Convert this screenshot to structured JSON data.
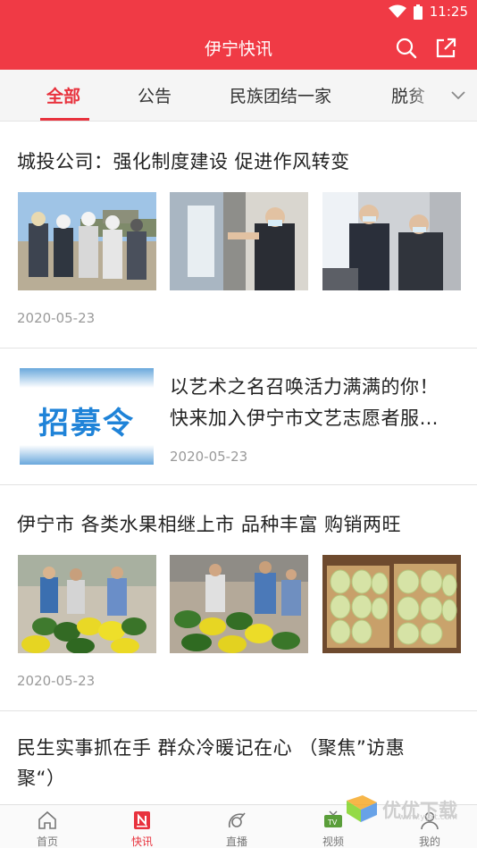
{
  "status_bar": {
    "time": "11:25"
  },
  "header": {
    "title": "伊宁快讯"
  },
  "tabs": [
    {
      "label": "全部",
      "active": true
    },
    {
      "label": "公告",
      "active": false
    },
    {
      "label": "民族团结一家",
      "active": false
    },
    {
      "label": "脱贫",
      "active": false
    }
  ],
  "articles": [
    {
      "title": "城投公司：强化制度建设   促进作风转变",
      "date": "2020-05-23",
      "images": [
        "construction-site-photo",
        "office-inspection-photo",
        "meeting-photo"
      ]
    },
    {
      "title_line1": "以艺术之名召唤活力满满的你！",
      "title_line2": "快来加入伊宁市文艺志愿者服…",
      "date": "2020-05-23",
      "banner_text": "招募令"
    },
    {
      "title": "伊宁市   各类水果相继上市   品种丰富   购销两旺",
      "date": "2020-05-23",
      "images": [
        "watermelon-market-photo",
        "watermelon-stall-photo",
        "melon-boxes-photo"
      ]
    },
    {
      "title_line1": "民生实事抓在手   群众冷暖记在心     （聚焦”访惠",
      "title_line2": "聚“）"
    }
  ],
  "bottom_nav": [
    {
      "label": "首页",
      "icon": "home-icon",
      "active": false
    },
    {
      "label": "快讯",
      "icon": "news-icon",
      "active": true
    },
    {
      "label": "直播",
      "icon": "live-icon",
      "active": false
    },
    {
      "label": "视频",
      "icon": "tv-icon",
      "active": false
    },
    {
      "label": "我的",
      "icon": "profile-icon",
      "active": false
    }
  ],
  "watermark": {
    "text": "优优下载",
    "url": "www.yyxt.com"
  },
  "colors": {
    "brand": "#f03a45",
    "active_tab": "#e8323d"
  }
}
